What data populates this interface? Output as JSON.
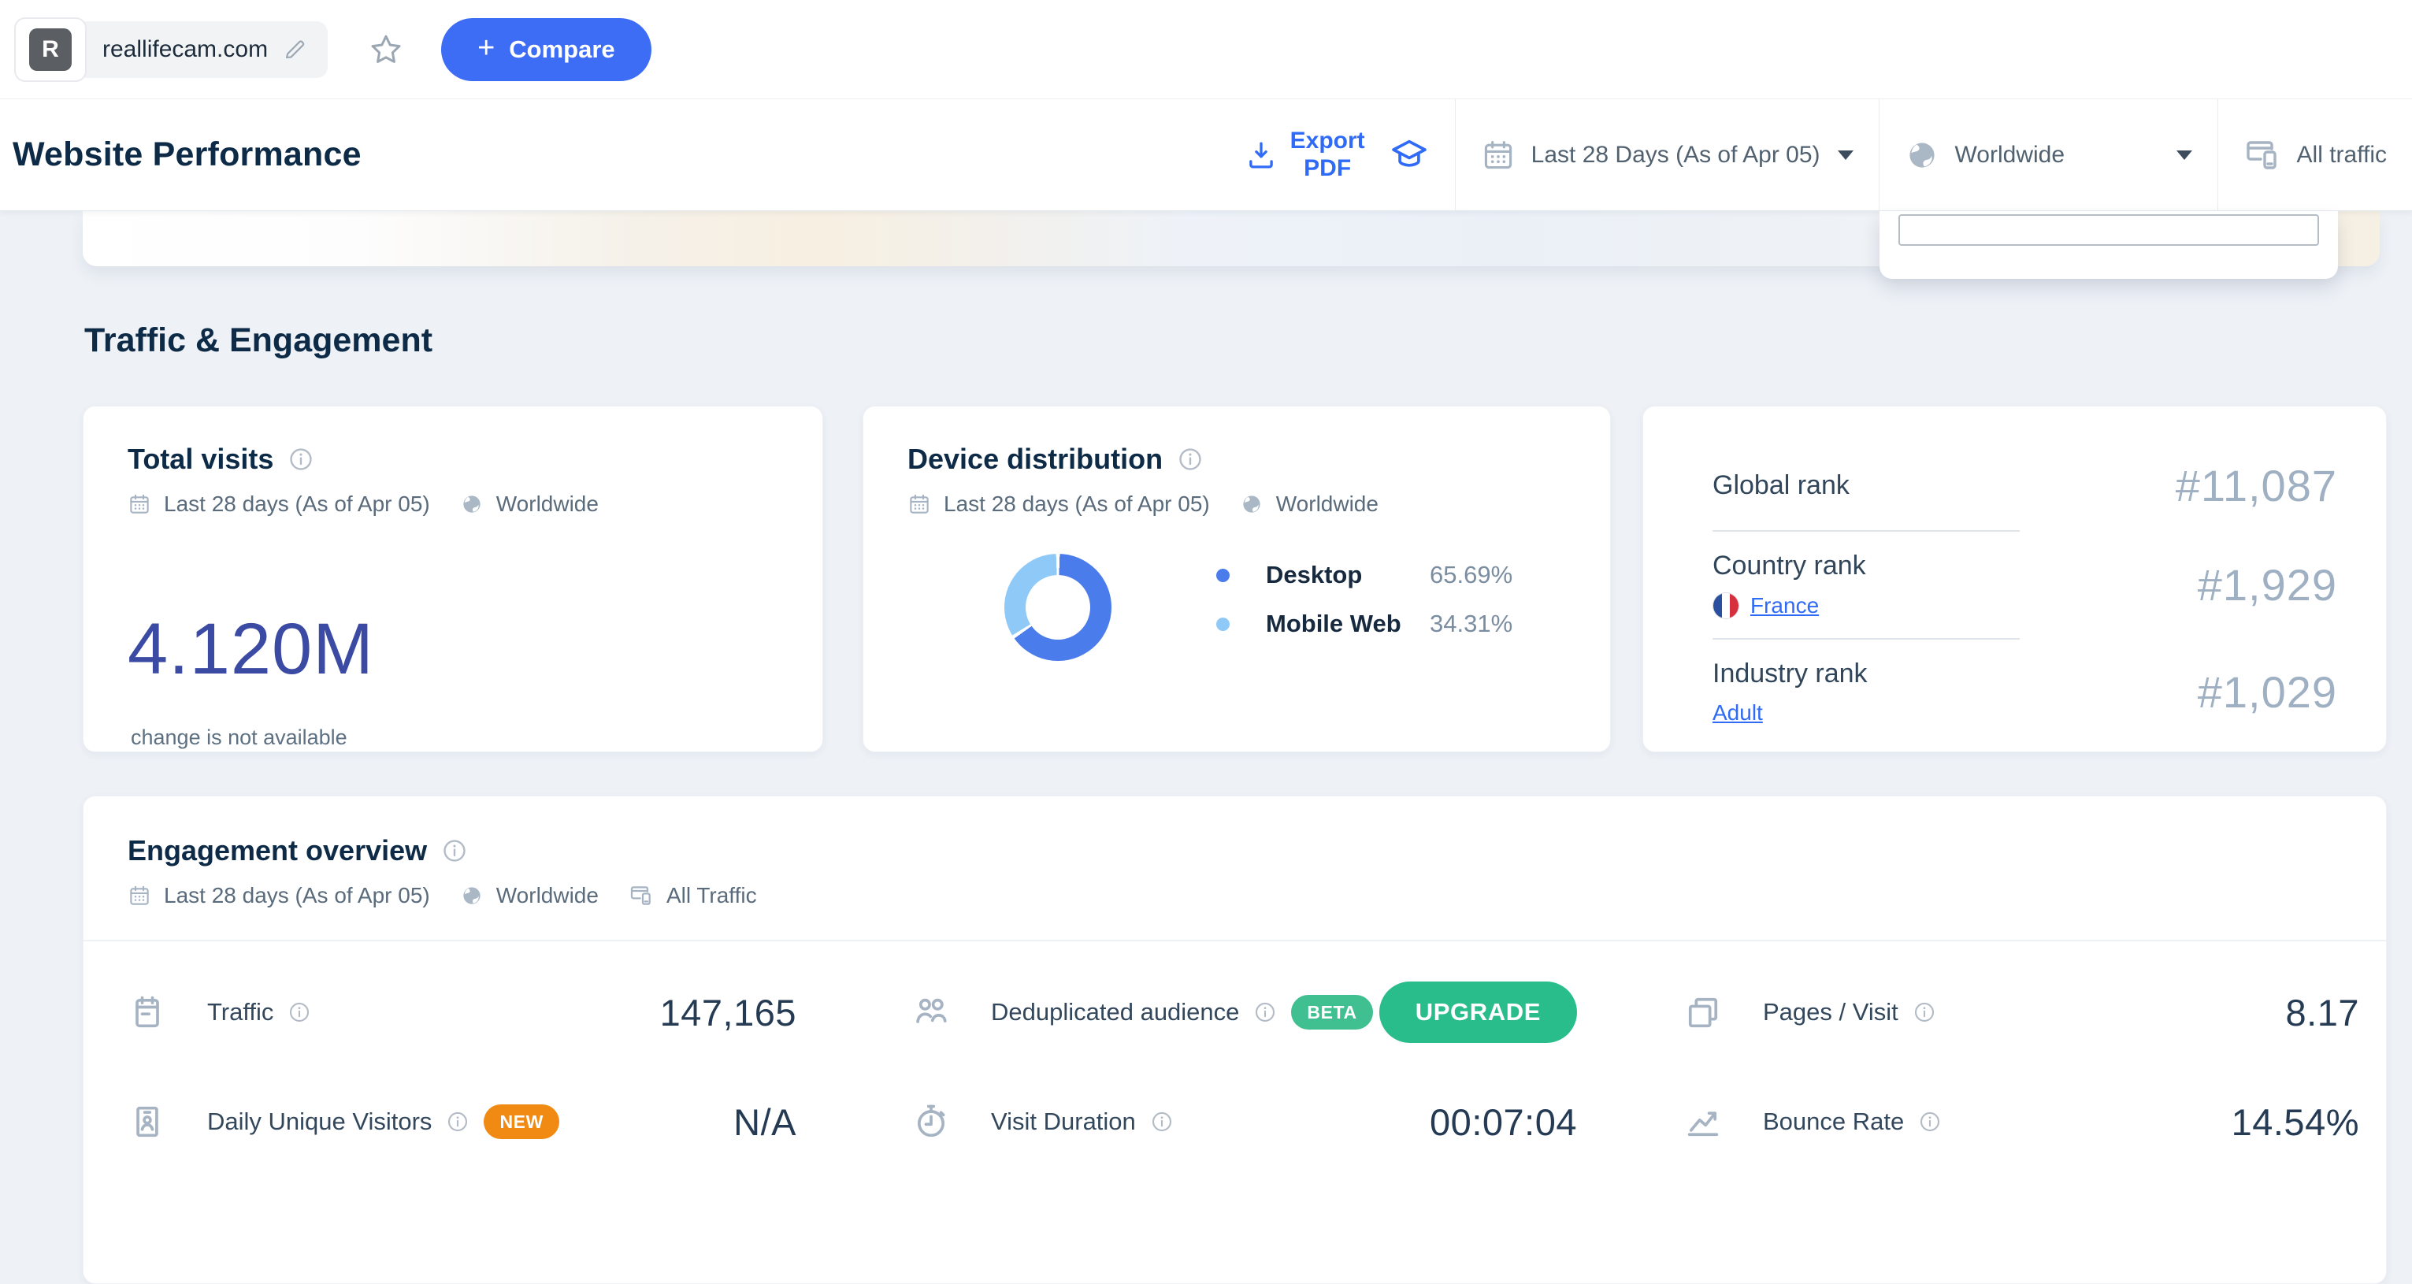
{
  "colors": {
    "accent-blue": "#3d6cf5",
    "link-blue": "#2f6bf6",
    "green-button": "#29bd8b",
    "green-badge": "#40bf90",
    "orange-badge": "#f08a12",
    "big-number-blue": "#3b4aa2",
    "value-navy": "#253b53",
    "rank-value-gray": "#9fb0c3"
  },
  "topbar": {
    "site_name": "reallifecam.com",
    "favicon_letter": "R",
    "compare_plus": "+",
    "compare_label": "Compare"
  },
  "header": {
    "title": "Website Performance",
    "export_line1": "Export",
    "export_line2": "PDF",
    "date_filter": "Last 28 Days (As of Apr 05)",
    "region_filter": "Worldwide",
    "traffic_filter": "All traffic"
  },
  "section": {
    "title": "Traffic & Engagement"
  },
  "total_visits": {
    "title": "Total visits",
    "date": "Last 28 days (As of Apr 05)",
    "region": "Worldwide",
    "value": "4.120M",
    "note": "change is not available"
  },
  "device_distribution": {
    "title": "Device distribution",
    "date": "Last 28 days (As of Apr 05)",
    "region": "Worldwide"
  },
  "chart_data": {
    "type": "pie",
    "title": "Device distribution",
    "labels": [
      "Desktop",
      "Mobile Web"
    ],
    "values": [
      65.69,
      34.31
    ],
    "value_labels": [
      "65.69%",
      "34.31%"
    ],
    "colors": [
      "#4a7cec",
      "#8ec9f8"
    ],
    "donut": true,
    "legend_position": "right"
  },
  "ranks": {
    "rows": [
      {
        "label": "Global rank",
        "value": "#11,087"
      },
      {
        "label": "Country rank",
        "link": "France",
        "value": "#1,929"
      },
      {
        "label": "Industry rank",
        "link": "Adult",
        "value": "#1,029"
      }
    ]
  },
  "engagement": {
    "title": "Engagement overview",
    "date": "Last 28 days (As of Apr 05)",
    "region": "Worldwide",
    "traffic": "All Traffic",
    "metrics": {
      "traffic": {
        "label": "Traffic",
        "value": "147,165"
      },
      "dedup": {
        "label": "Deduplicated audience",
        "badge": "BETA",
        "action": "UPGRADE"
      },
      "pages": {
        "label": "Pages / Visit",
        "value": "8.17"
      },
      "duv": {
        "label": "Daily Unique Visitors",
        "badge": "NEW",
        "value": "N/A"
      },
      "duration": {
        "label": "Visit Duration",
        "value": "00:07:04"
      },
      "bounce": {
        "label": "Bounce Rate",
        "value": "14.54%"
      }
    }
  }
}
